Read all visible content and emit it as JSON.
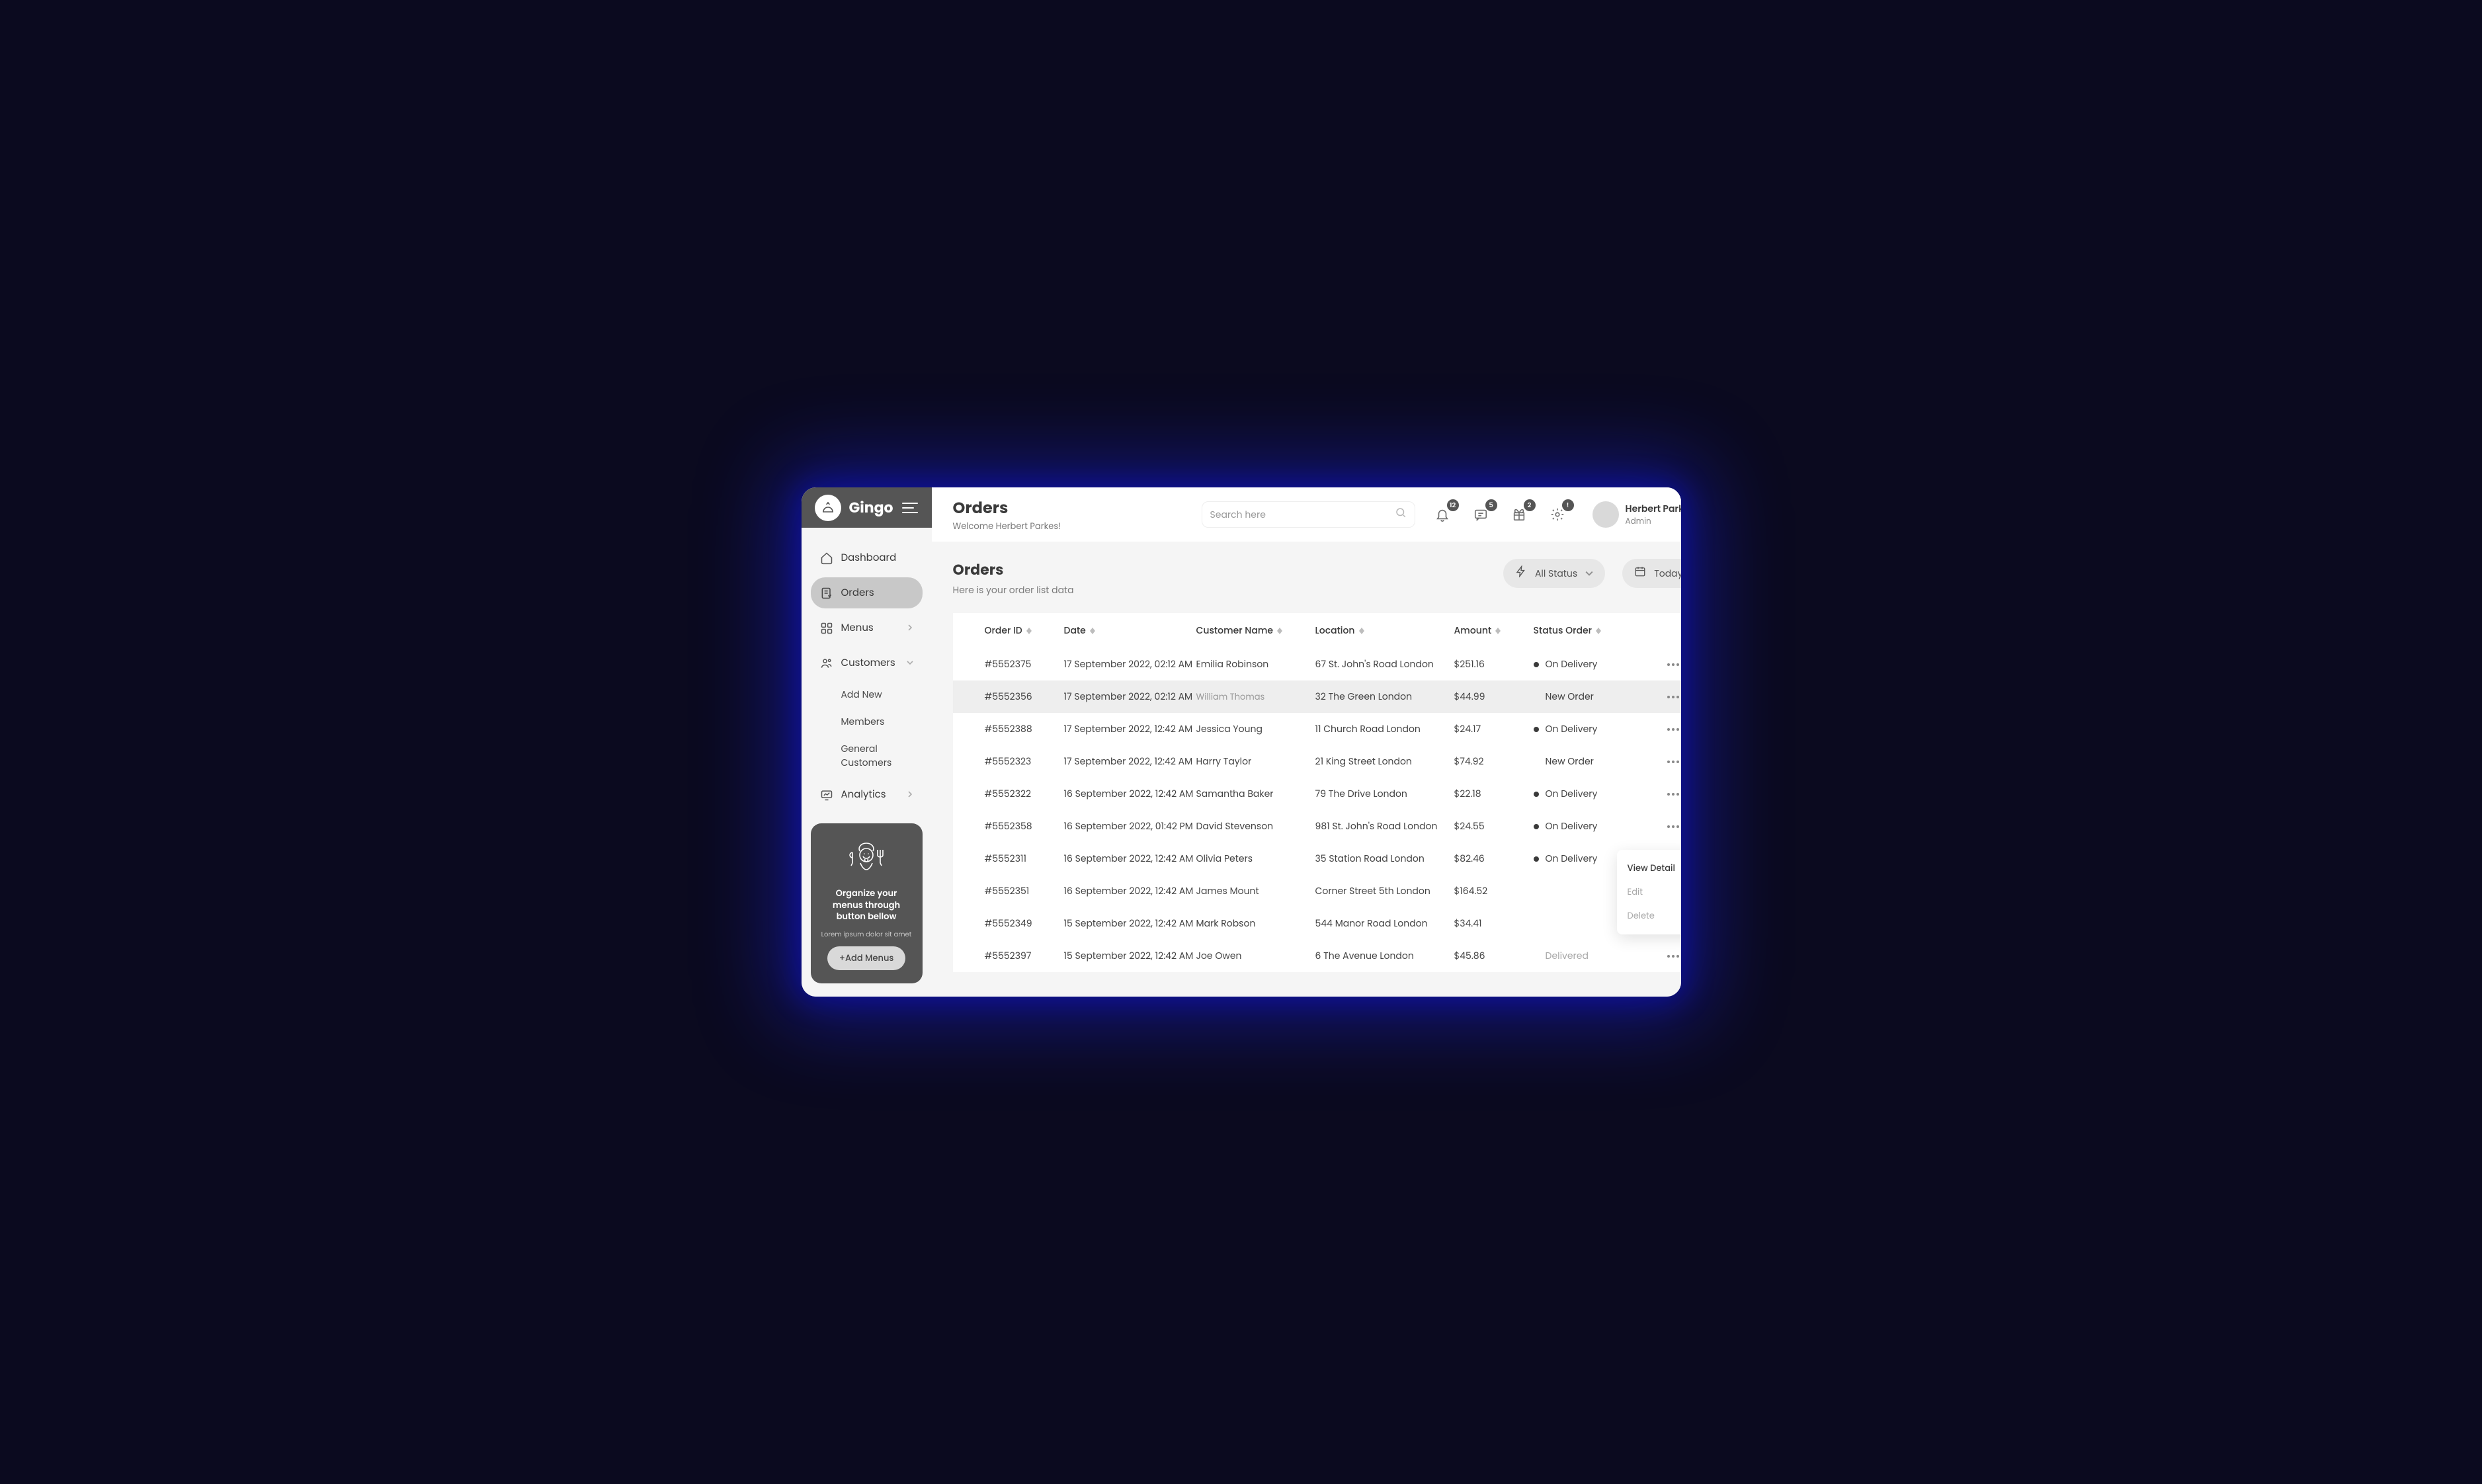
{
  "brand": "Gingo",
  "sidebar": {
    "items": [
      {
        "label": "Dashboard"
      },
      {
        "label": "Orders"
      },
      {
        "label": "Menus"
      },
      {
        "label": "Customers"
      },
      {
        "label": "Analytics"
      }
    ],
    "customer_sub": [
      {
        "label": "Add New"
      },
      {
        "label": "Members"
      },
      {
        "label": "General Customers"
      }
    ]
  },
  "promo": {
    "title": "Organize your menus through button bellow",
    "sub": "Lorem ipsum dolor sit amet",
    "button": "+Add Menus"
  },
  "header": {
    "title": "Orders",
    "welcome": "Welcome Herbert Parkes!",
    "search_placeholder": "Search here",
    "badges": {
      "bell": "12",
      "chat": "5",
      "gift": "2",
      "gear": "!"
    }
  },
  "user": {
    "name": "Herbert Parkes",
    "role": "Admin"
  },
  "page": {
    "title": "Orders",
    "subtitle": "Here is your order list data",
    "filter_status": "All Status",
    "filter_date": "Today"
  },
  "table": {
    "headers": {
      "id": "Order ID",
      "date": "Date",
      "customer": "Customer Name",
      "location": "Location",
      "amount": "Amount",
      "status": "Status Order"
    },
    "rows": [
      {
        "id": "#5552375",
        "date": "17 September 2022, 02:12 AM",
        "customer": "Emilia Robinson",
        "location": "67 St. John's Road London",
        "amount": "$251.16",
        "status": "On Delivery",
        "dot": true
      },
      {
        "id": "#5552356",
        "date": "17 September 2022, 02:12 AM",
        "customer": "William Thomas",
        "customer_muted": true,
        "location": "32 The Green London",
        "amount": "$44.99",
        "status": "New Order",
        "dot": false,
        "alt": true
      },
      {
        "id": "#5552388",
        "date": "17 September 2022, 12:42 AM",
        "customer": "Jessica Young",
        "location": "11 Church Road London",
        "amount": "$24.17",
        "status": "On Delivery",
        "dot": true
      },
      {
        "id": "#5552323",
        "date": "17 September 2022, 12:42 AM",
        "customer": "Harry Taylor",
        "location": "21 King Street London",
        "amount": "$74.92",
        "status": "New Order",
        "dot": false
      },
      {
        "id": "#5552322",
        "date": "16 September 2022, 12:42 AM",
        "customer": "Samantha Baker",
        "location": "79 The Drive London",
        "amount": "$22.18",
        "status": "On Delivery",
        "dot": true
      },
      {
        "id": "#5552358",
        "date": "16 September 2022, 01:42 PM",
        "customer": "David Stevenson",
        "location": "981 St. John's Road London",
        "amount": "$24.55",
        "status": "On Delivery",
        "dot": true
      },
      {
        "id": "#5552311",
        "date": "16 September 2022, 12:42 AM",
        "customer": "Olivia Peters",
        "location": "35 Station Road London",
        "amount": "$82.46",
        "status": "On Delivery",
        "dot": true
      },
      {
        "id": "#5552351",
        "date": "16 September 2022, 12:42 AM",
        "customer": "James Mount",
        "location": "Corner Street 5th London",
        "amount": "$164.52",
        "status": "",
        "dot": false
      },
      {
        "id": "#5552349",
        "date": "15 September 2022, 12:42 AM",
        "customer": "Mark Robson",
        "location": "544 Manor Road London",
        "amount": "$34.41",
        "status": "",
        "dot": false
      },
      {
        "id": "#5552397",
        "date": "15 September 2022, 12:42 AM",
        "customer": "Joe Owen",
        "location": "6 The Avenue London",
        "amount": "$45.86",
        "status": "Delivered",
        "muted": true,
        "dot": false
      }
    ]
  },
  "popup": {
    "view": "View Detail",
    "edit": "Edit",
    "delete": "Delete"
  }
}
